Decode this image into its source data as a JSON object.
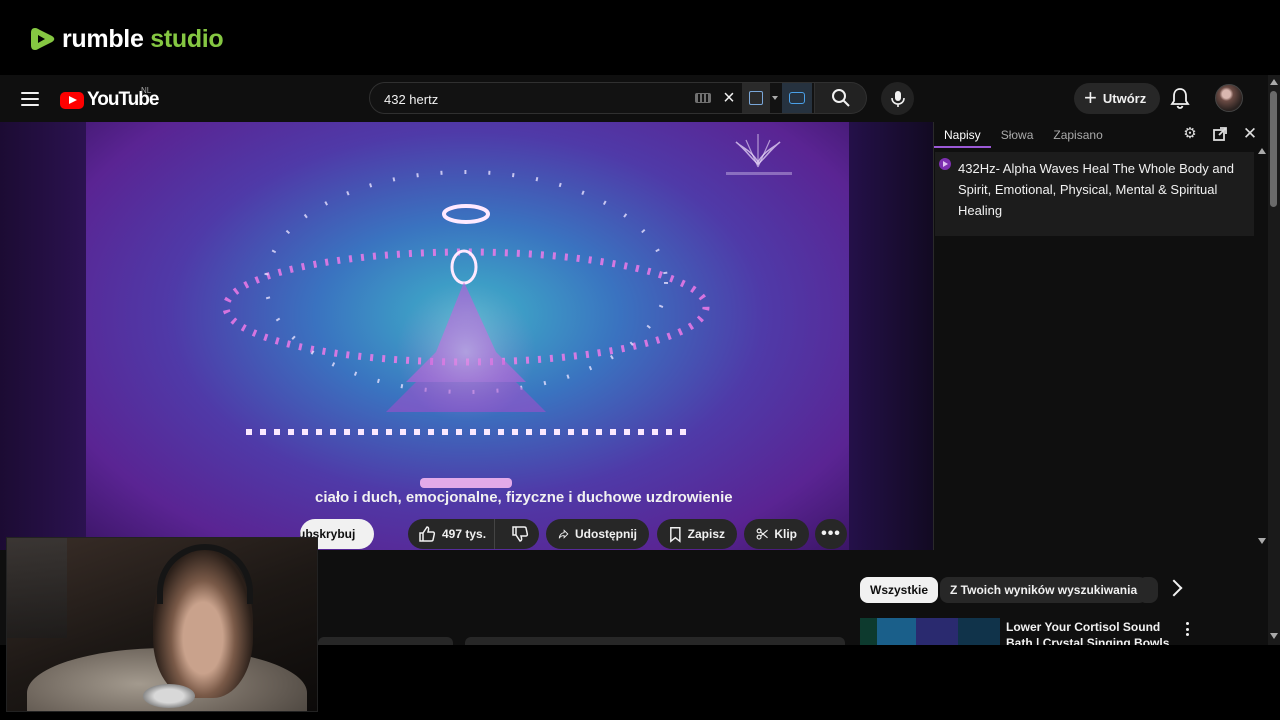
{
  "branding": {
    "word1": "rumble",
    "word2": "studio"
  },
  "youtube": {
    "logo_text": "YouTube",
    "country_code": "NL",
    "search": {
      "value": "432 hertz",
      "placeholder": ""
    },
    "create_label": "Utwórz"
  },
  "subtitles_panel": {
    "tabs": [
      {
        "label": "Napisy",
        "active": true
      },
      {
        "label": "Słowa",
        "active": false
      },
      {
        "label": "Zapisano",
        "active": false
      }
    ],
    "lines": [
      "432Hz- Alpha Waves Heal The Whole Body and Spirit, Emotional, Physical, Mental & Spiritual Healing"
    ]
  },
  "video": {
    "title": "ciało i duch, emocjonalne, fizyczne i duchowe uzdrowienie",
    "subscribe_label": "Subskrybuj",
    "likes": "497 tys.",
    "share_label": "Udostępnij",
    "save_label": "Zapisz",
    "clip_label": "Klip"
  },
  "filters": {
    "chips": [
      "Wszystkie",
      "Z Twoich wyników wyszukiwania"
    ]
  },
  "recommended": [
    {
      "title": "Lower Your Cortisol Sound Bath | Crystal Singing Bowls for"
    }
  ],
  "colors": {
    "rumble_green": "#85c742",
    "yt_red": "#ff0000",
    "background": "#0f0f0f",
    "active_tab_underline": "#9b59d6"
  },
  "icons": [
    "hamburger-menu-icon",
    "keyboard-icon",
    "clear-icon",
    "translate-icon",
    "captions-icon",
    "search-icon",
    "mic-icon",
    "plus-icon",
    "bell-icon",
    "gear-icon",
    "popout-icon",
    "close-icon",
    "thumbs-up-icon",
    "thumbs-down-icon",
    "share-icon",
    "bookmark-icon",
    "scissors-icon",
    "more-horizontal-icon",
    "chevron-right-icon",
    "more-vertical-icon"
  ]
}
